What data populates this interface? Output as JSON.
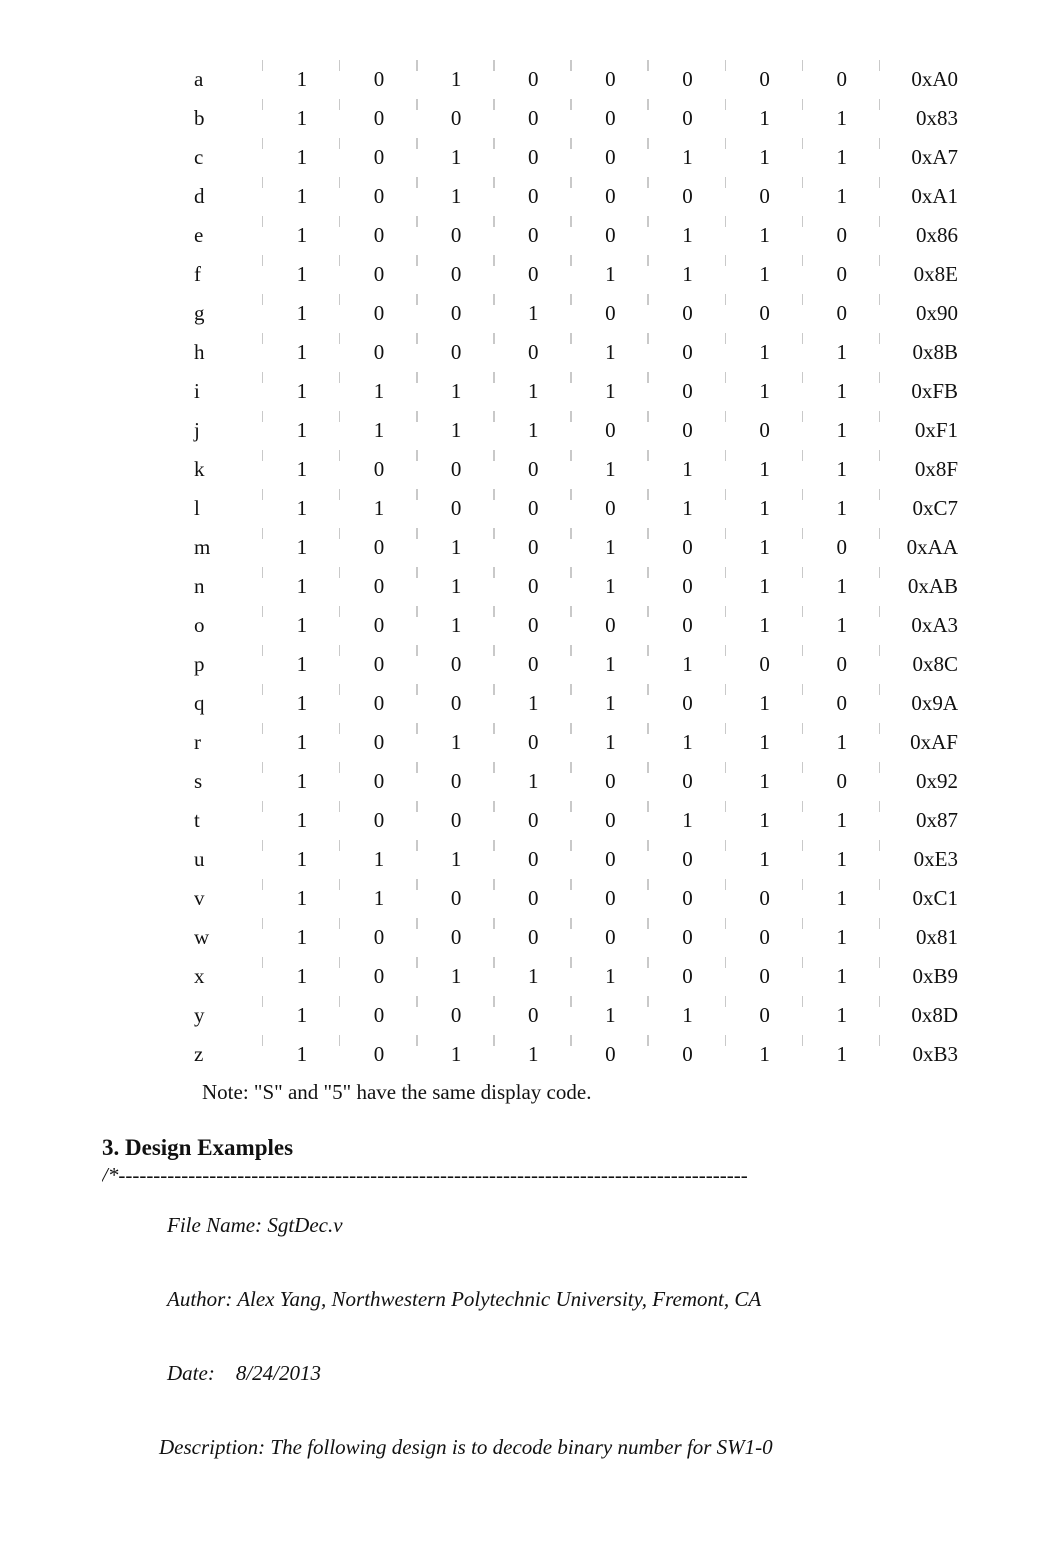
{
  "table": {
    "rows": [
      {
        "ch": "a",
        "bits": [
          "1",
          "0",
          "1",
          "0",
          "0",
          "0",
          "0",
          "0"
        ],
        "hex": "0xA0"
      },
      {
        "ch": "b",
        "bits": [
          "1",
          "0",
          "0",
          "0",
          "0",
          "0",
          "1",
          "1"
        ],
        "hex": "0x83"
      },
      {
        "ch": "c",
        "bits": [
          "1",
          "0",
          "1",
          "0",
          "0",
          "1",
          "1",
          "1"
        ],
        "hex": "0xA7"
      },
      {
        "ch": "d",
        "bits": [
          "1",
          "0",
          "1",
          "0",
          "0",
          "0",
          "0",
          "1"
        ],
        "hex": "0xA1"
      },
      {
        "ch": "e",
        "bits": [
          "1",
          "0",
          "0",
          "0",
          "0",
          "1",
          "1",
          "0"
        ],
        "hex": "0x86"
      },
      {
        "ch": "f",
        "bits": [
          "1",
          "0",
          "0",
          "0",
          "1",
          "1",
          "1",
          "0"
        ],
        "hex": "0x8E"
      },
      {
        "ch": "g",
        "bits": [
          "1",
          "0",
          "0",
          "1",
          "0",
          "0",
          "0",
          "0"
        ],
        "hex": "0x90"
      },
      {
        "ch": "h",
        "bits": [
          "1",
          "0",
          "0",
          "0",
          "1",
          "0",
          "1",
          "1"
        ],
        "hex": "0x8B"
      },
      {
        "ch": "i",
        "bits": [
          "1",
          "1",
          "1",
          "1",
          "1",
          "0",
          "1",
          "1"
        ],
        "hex": "0xFB"
      },
      {
        "ch": "j",
        "bits": [
          "1",
          "1",
          "1",
          "1",
          "0",
          "0",
          "0",
          "1"
        ],
        "hex": "0xF1"
      },
      {
        "ch": "k",
        "bits": [
          "1",
          "0",
          "0",
          "0",
          "1",
          "1",
          "1",
          "1"
        ],
        "hex": "0x8F"
      },
      {
        "ch": "l",
        "bits": [
          "1",
          "1",
          "0",
          "0",
          "0",
          "1",
          "1",
          "1"
        ],
        "hex": "0xC7"
      },
      {
        "ch": "m",
        "bits": [
          "1",
          "0",
          "1",
          "0",
          "1",
          "0",
          "1",
          "0"
        ],
        "hex": "0xAA"
      },
      {
        "ch": "n",
        "bits": [
          "1",
          "0",
          "1",
          "0",
          "1",
          "0",
          "1",
          "1"
        ],
        "hex": "0xAB"
      },
      {
        "ch": "o",
        "bits": [
          "1",
          "0",
          "1",
          "0",
          "0",
          "0",
          "1",
          "1"
        ],
        "hex": "0xA3"
      },
      {
        "ch": "p",
        "bits": [
          "1",
          "0",
          "0",
          "0",
          "1",
          "1",
          "0",
          "0"
        ],
        "hex": "0x8C"
      },
      {
        "ch": "q",
        "bits": [
          "1",
          "0",
          "0",
          "1",
          "1",
          "0",
          "1",
          "0"
        ],
        "hex": "0x9A"
      },
      {
        "ch": "r",
        "bits": [
          "1",
          "0",
          "1",
          "0",
          "1",
          "1",
          "1",
          "1"
        ],
        "hex": "0xAF"
      },
      {
        "ch": "s",
        "bits": [
          "1",
          "0",
          "0",
          "1",
          "0",
          "0",
          "1",
          "0"
        ],
        "hex": "0x92"
      },
      {
        "ch": "t",
        "bits": [
          "1",
          "0",
          "0",
          "0",
          "0",
          "1",
          "1",
          "1"
        ],
        "hex": "0x87"
      },
      {
        "ch": "u",
        "bits": [
          "1",
          "1",
          "1",
          "0",
          "0",
          "0",
          "1",
          "1"
        ],
        "hex": "0xE3"
      },
      {
        "ch": "v",
        "bits": [
          "1",
          "1",
          "0",
          "0",
          "0",
          "0",
          "0",
          "1"
        ],
        "hex": "0xC1"
      },
      {
        "ch": "w",
        "bits": [
          "1",
          "0",
          "0",
          "0",
          "0",
          "0",
          "0",
          "1"
        ],
        "hex": "0x81"
      },
      {
        "ch": "x",
        "bits": [
          "1",
          "0",
          "1",
          "1",
          "1",
          "0",
          "0",
          "1"
        ],
        "hex": "0xB9"
      },
      {
        "ch": "y",
        "bits": [
          "1",
          "0",
          "0",
          "0",
          "1",
          "1",
          "0",
          "1"
        ],
        "hex": "0x8D"
      },
      {
        "ch": "z",
        "bits": [
          "1",
          "0",
          "1",
          "1",
          "0",
          "0",
          "1",
          "1"
        ],
        "hex": "0xB3"
      }
    ],
    "note": "Note: \"S\" and \"5\" have the same display code."
  },
  "section": {
    "number": "3.",
    "title": "Design  Examples"
  },
  "code_header": {
    "dash_prefix": "/*",
    "file_label": "File Name:",
    "file_value": "SgtDec.v",
    "author_label": "Author:",
    "author_value": "Alex Yang, Northwestern Polytechnic University, Fremont, CA",
    "date_label": "Date:",
    "date_value": "8/24/2013",
    "desc_label": "Description:",
    "desc_value": "The following design is to decode binary number for SW1-0"
  }
}
